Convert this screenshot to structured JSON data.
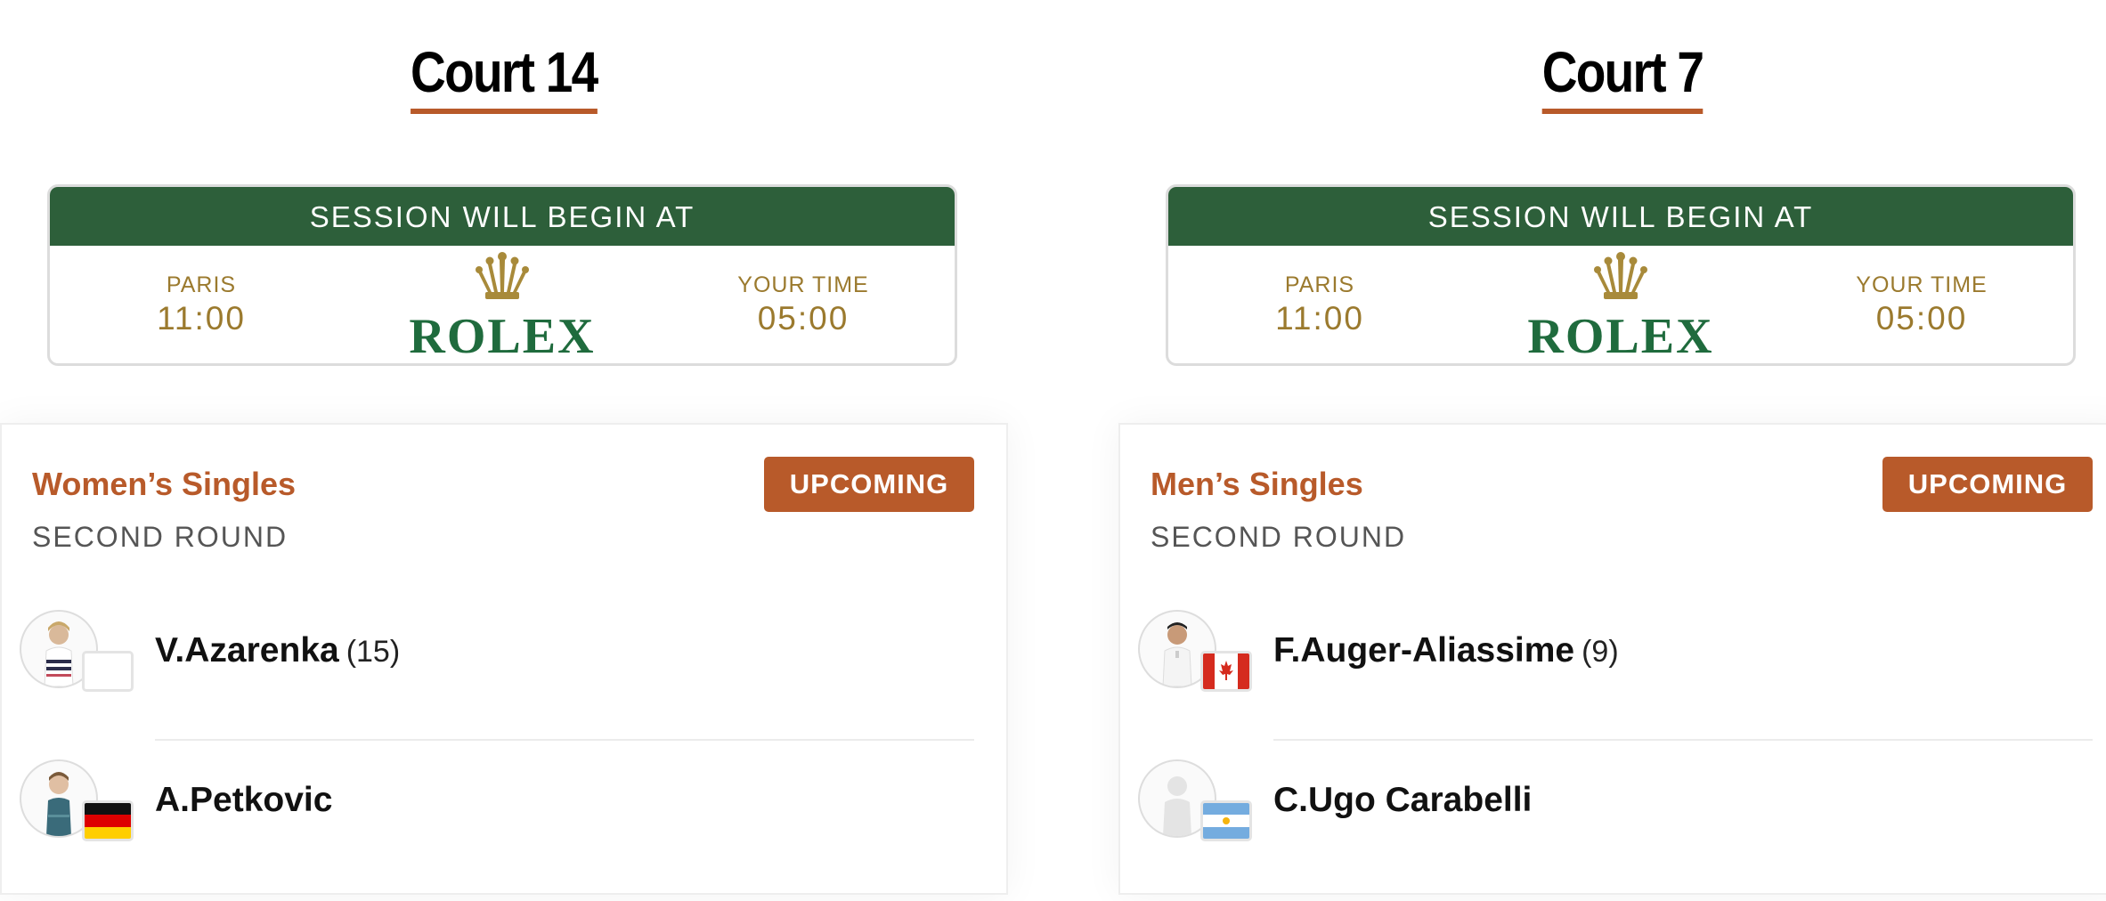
{
  "courts": [
    {
      "title": "Court 14",
      "session": {
        "header": "SESSION WILL BEGIN AT",
        "paris_label": "PARIS",
        "paris_time": "11:00",
        "brand": "ROLEX",
        "your_label": "YOUR TIME",
        "your_time": "05:00"
      },
      "match": {
        "event": "Women’s Singles",
        "round": "SECOND ROUND",
        "status": "UPCOMING",
        "players": [
          {
            "name": "V.Azarenka",
            "seed": "(15)",
            "flag": "blank-flag"
          },
          {
            "name": "A.Petkovic",
            "seed": "",
            "flag": "germany-flag"
          }
        ]
      }
    },
    {
      "title": "Court 7",
      "session": {
        "header": "SESSION WILL BEGIN AT",
        "paris_label": "PARIS",
        "paris_time": "11:00",
        "brand": "ROLEX",
        "your_label": "YOUR TIME",
        "your_time": "05:00"
      },
      "match": {
        "event": "Men’s Singles",
        "round": "SECOND ROUND",
        "status": "UPCOMING",
        "players": [
          {
            "name": "F.Auger-Aliassime",
            "seed": "(9)",
            "flag": "canada-flag"
          },
          {
            "name": "C.Ugo Carabelli",
            "seed": "",
            "flag": "argentina-flag"
          }
        ]
      }
    }
  ],
  "colors": {
    "accent": "#b85a2a",
    "rolex_green": "#2d5f3a",
    "gold": "#9b7a2e"
  }
}
